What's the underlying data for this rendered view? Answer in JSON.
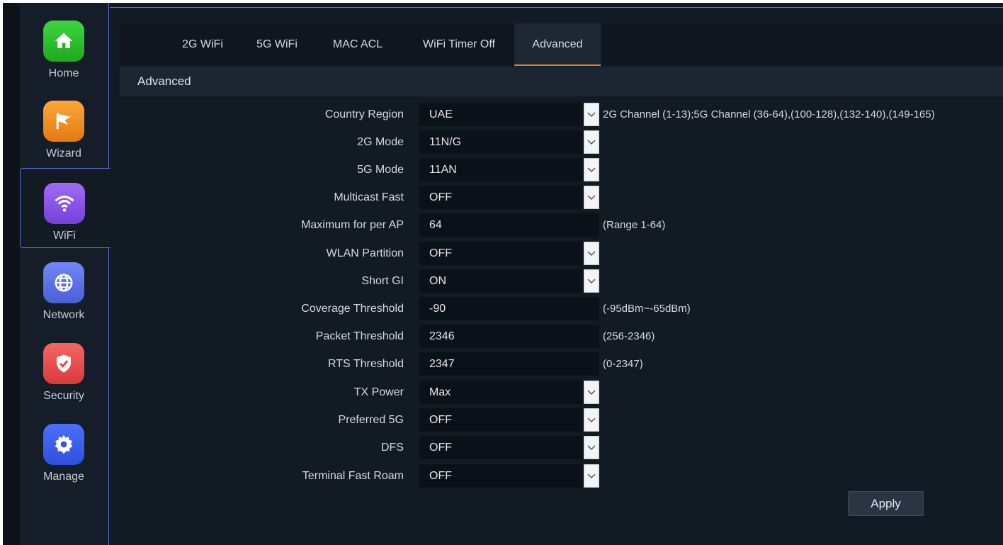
{
  "sidebar": {
    "items": [
      {
        "label": "Home",
        "color": "#2dbf2d"
      },
      {
        "label": "Wizard",
        "color": "#f08a1c"
      },
      {
        "label": "WiFi",
        "color": "#8a55e8"
      },
      {
        "label": "Network",
        "color": "#5b6fe8"
      },
      {
        "label": "Security",
        "color": "#e85050"
      },
      {
        "label": "Manage",
        "color": "#3b5ef0"
      }
    ]
  },
  "tabs": [
    {
      "label": "2G WiFi"
    },
    {
      "label": "5G WiFi"
    },
    {
      "label": "MAC ACL"
    },
    {
      "label": "WiFi Timer Off"
    },
    {
      "label": "Advanced"
    }
  ],
  "section_title": "Advanced",
  "fields": [
    {
      "label": "Country Region",
      "value": "UAE",
      "hint": "2G Channel (1-13);5G Channel (36-64),(100-128),(132-140),(149-165)"
    },
    {
      "label": "2G Mode",
      "value": "11N/G"
    },
    {
      "label": "5G Mode",
      "value": "11AN"
    },
    {
      "label": "Multicast Fast",
      "value": "OFF"
    },
    {
      "label": "Maximum for per AP",
      "value": "64",
      "hint": "(Range 1-64)"
    },
    {
      "label": "WLAN Partition",
      "value": "OFF"
    },
    {
      "label": "Short GI",
      "value": "ON"
    },
    {
      "label": "Coverage Threshold",
      "value": "-90",
      "hint": "(-95dBm~-65dBm)"
    },
    {
      "label": "Packet Threshold",
      "value": "2346",
      "hint": "(256-2346)"
    },
    {
      "label": "RTS Threshold",
      "value": "2347",
      "hint": "(0-2347)"
    },
    {
      "label": "TX Power",
      "value": "Max"
    },
    {
      "label": "Preferred 5G",
      "value": "OFF"
    },
    {
      "label": "DFS",
      "value": "OFF"
    },
    {
      "label": "Terminal Fast Roam",
      "value": "OFF"
    }
  ],
  "apply_label": "Apply",
  "colors": {
    "accent": "#e08a2c",
    "border": "#5a6fd6"
  }
}
